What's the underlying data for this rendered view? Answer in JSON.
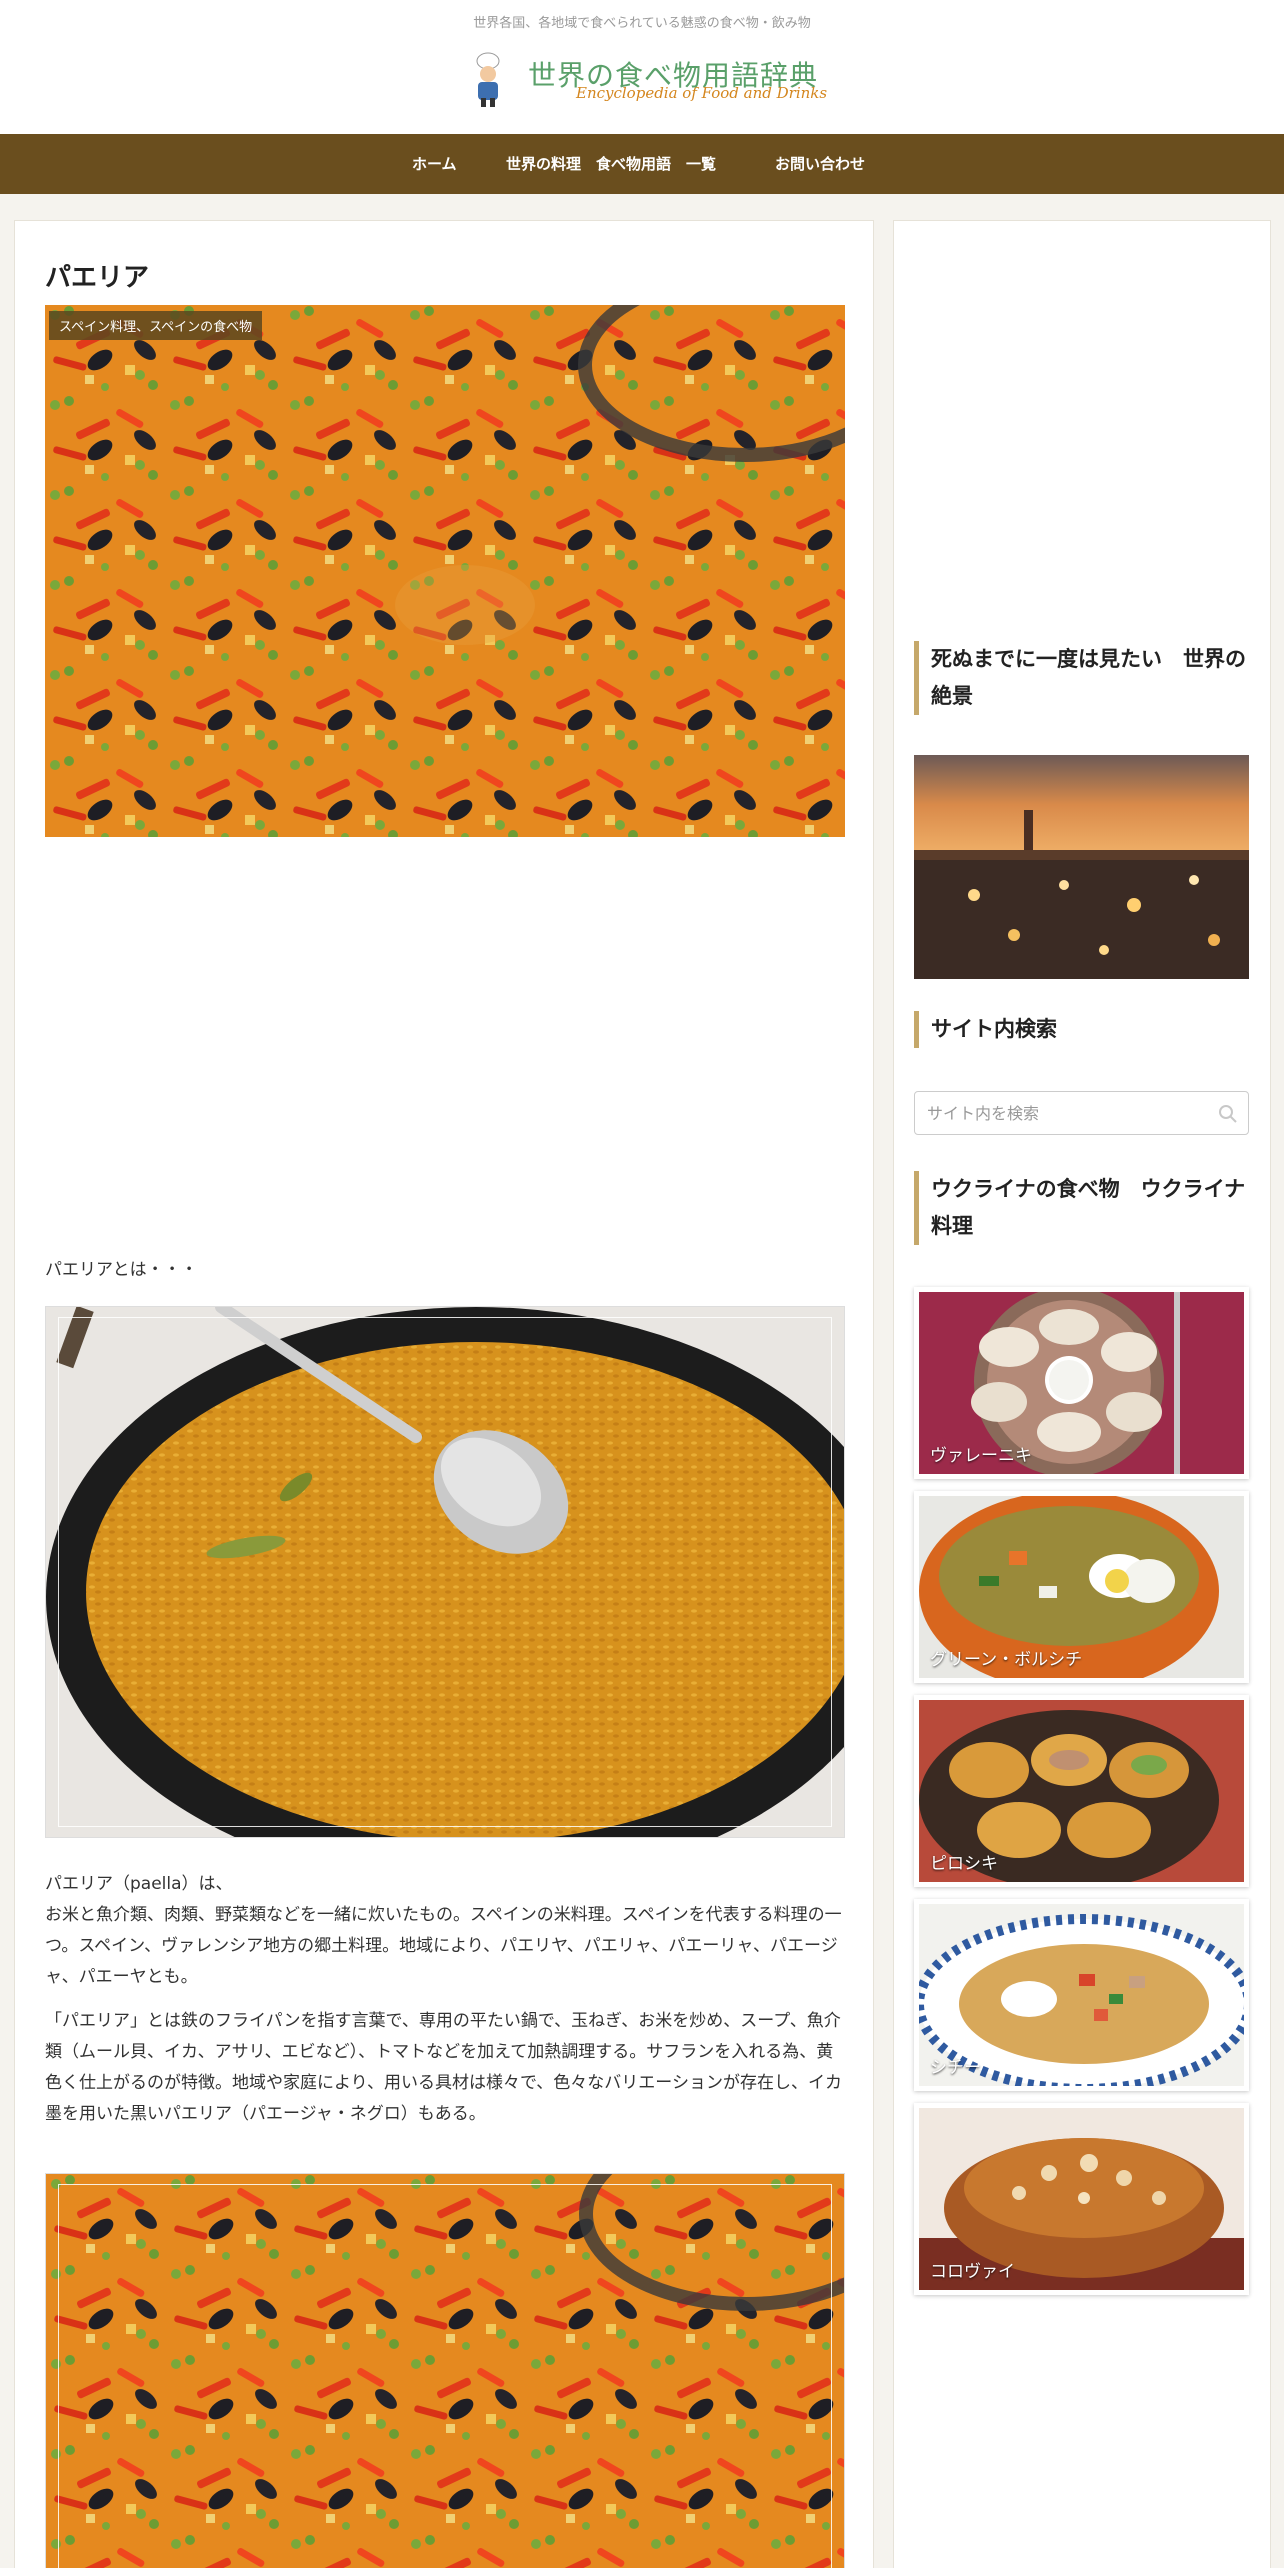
{
  "header": {
    "tagline": "世界各国、各地域で食べられている魅惑の食べ物・飲み物",
    "logo_jp": "世界の食べ物用語辞典",
    "logo_en": "Encyclopedia of Food and Drinks"
  },
  "nav": {
    "items": [
      "ホーム",
      "世界の料理　食べ物用語　一覧",
      "お問い合わせ"
    ]
  },
  "article": {
    "title": "パエリア",
    "category": "スペイン料理、スペインの食べ物",
    "lead": "パエリアとは・・・",
    "para1_line1": "パエリア（paella）は、",
    "para1_body": "お米と魚介類、肉類、野菜類などを一緒に炊いたもの。スペインの米料理。スペインを代表する料理の一つ。スペイン、ヴァレンシア地方の郷土料理。地域により、パエリヤ、パエリャ、パエーリャ、パエージャ、パエーヤとも。",
    "para2": "「パエリア」とは鉄のフライパンを指す言葉で、専用の平たい鍋で、玉ねぎ、お米を炒め、スープ、魚介類（ムール貝、イカ、アサリ、エビなど）、トマトなどを加えて加熱調理する。サフランを入れる為、黄色く仕上がるのが特徴。地域や家庭により、用いる具材は様々で、色々なバリエーションが存在し、イカ墨を用いた黒いパエリア（パエージャ・ネグロ）もある。"
  },
  "sidebar": {
    "heading1": "死ぬまでに一度は見たい　世界の絶景",
    "heading2": "サイト内検索",
    "search_placeholder": "サイト内を検索",
    "heading3": "ウクライナの食べ物　ウクライナ料理",
    "cards": [
      {
        "label": "ヴァレーニキ"
      },
      {
        "label": "グリーン・ボルシチ"
      },
      {
        "label": "ピロシキ"
      },
      {
        "label": "シチー"
      },
      {
        "label": "コロヴァイ"
      }
    ]
  },
  "colors": {
    "nav_bg": "#6a4e1e",
    "heading_accent": "#c5a86a",
    "logo_green": "#5aa06a",
    "logo_orange": "#d4861e"
  }
}
